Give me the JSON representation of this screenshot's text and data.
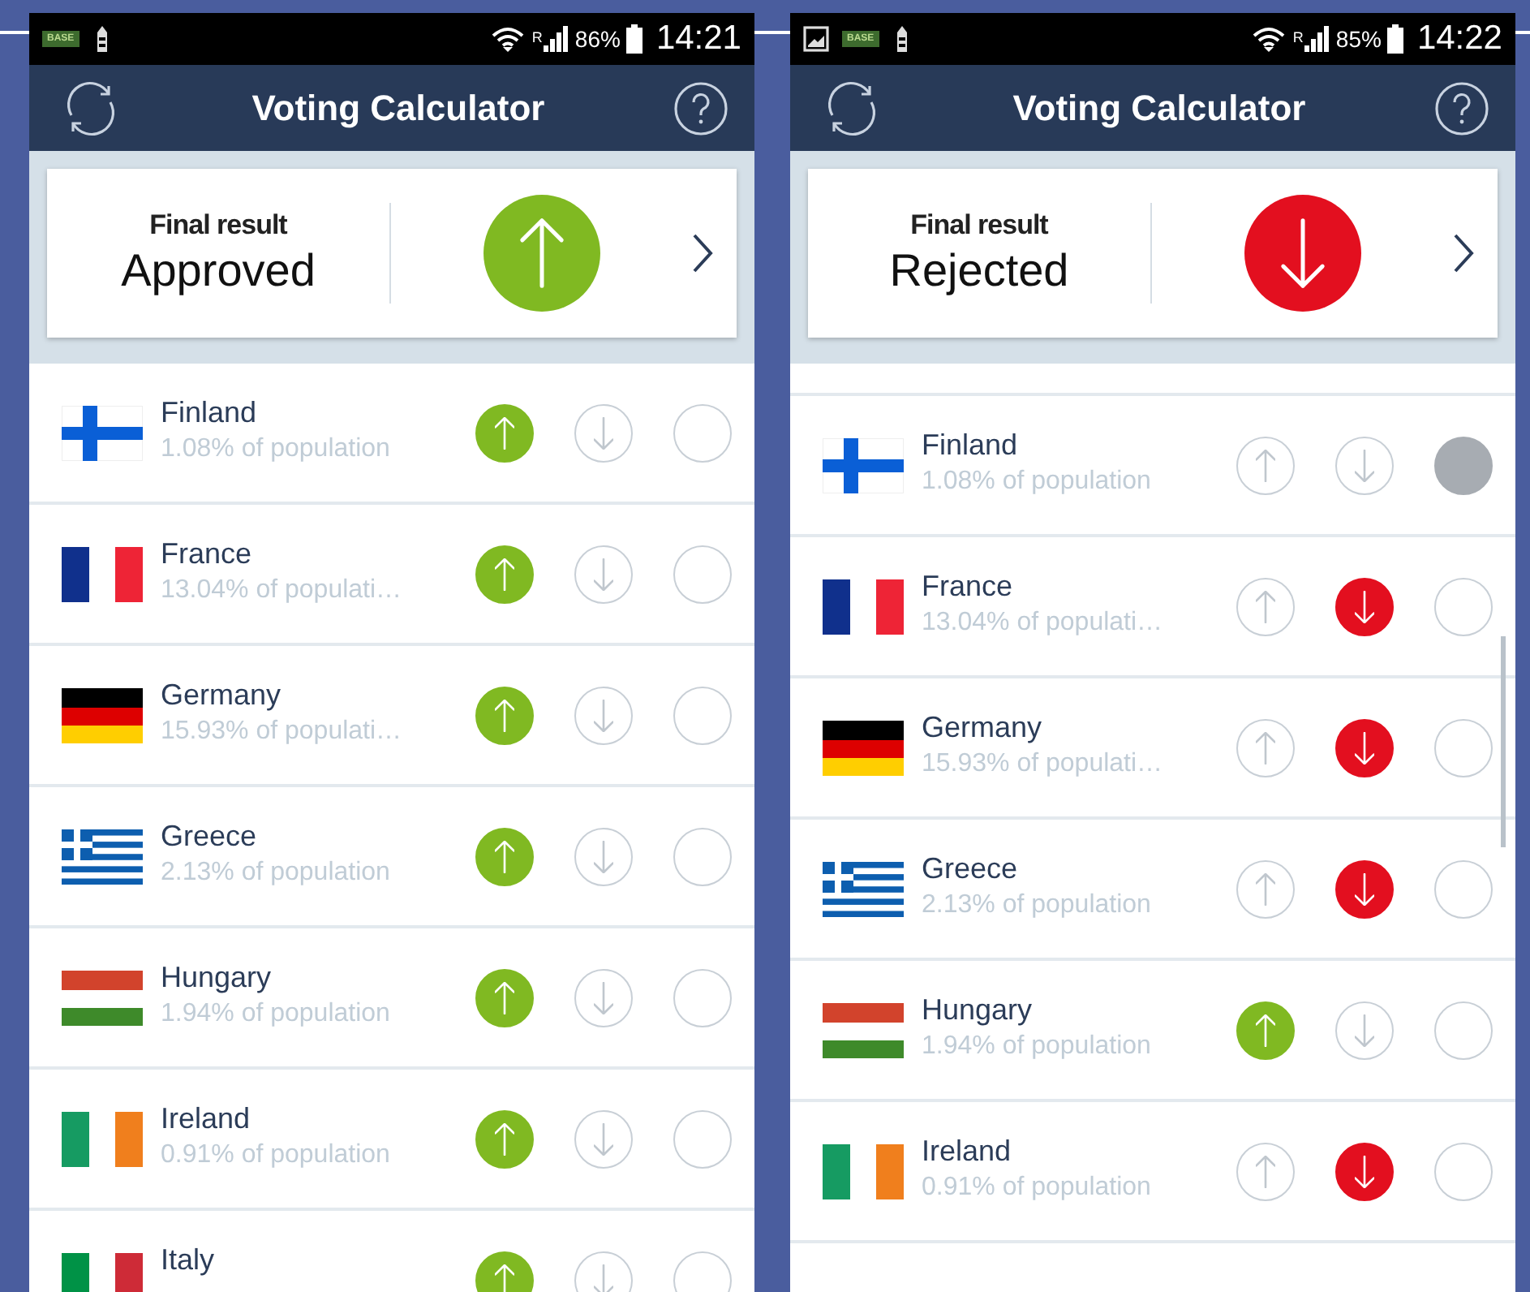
{
  "screens": [
    {
      "status": {
        "notifications": [
          {
            "kind": "badge",
            "text": "BASE"
          },
          {
            "kind": "tower"
          }
        ],
        "roaming": "R",
        "battery": "86%",
        "time": "14:21"
      },
      "title": "Voting Calculator",
      "result": {
        "label": "Final result",
        "value": "Approved",
        "kind": "approved"
      },
      "scrolled": false,
      "scrollbar": false,
      "countries": [
        {
          "kind": "fi",
          "name": "Finland",
          "population": "1.08% of population",
          "options": [
            {
              "kind": "yes",
              "selected": true
            },
            {
              "kind": "no",
              "selected": false
            },
            {
              "kind": "abstain",
              "selected": false
            }
          ]
        },
        {
          "kind": "fr",
          "name": "France",
          "population": "13.04% of populati…",
          "options": [
            {
              "kind": "yes",
              "selected": true
            },
            {
              "kind": "no",
              "selected": false
            },
            {
              "kind": "abstain",
              "selected": false
            }
          ]
        },
        {
          "kind": "de",
          "name": "Germany",
          "population": "15.93% of populati…",
          "options": [
            {
              "kind": "yes",
              "selected": true
            },
            {
              "kind": "no",
              "selected": false
            },
            {
              "kind": "abstain",
              "selected": false
            }
          ]
        },
        {
          "kind": "gr",
          "name": "Greece",
          "population": "2.13% of population",
          "options": [
            {
              "kind": "yes",
              "selected": true
            },
            {
              "kind": "no",
              "selected": false
            },
            {
              "kind": "abstain",
              "selected": false
            }
          ]
        },
        {
          "kind": "hu",
          "name": "Hungary",
          "population": "1.94% of population",
          "options": [
            {
              "kind": "yes",
              "selected": true
            },
            {
              "kind": "no",
              "selected": false
            },
            {
              "kind": "abstain",
              "selected": false
            }
          ]
        },
        {
          "kind": "ie",
          "name": "Ireland",
          "population": "0.91% of population",
          "options": [
            {
              "kind": "yes",
              "selected": true
            },
            {
              "kind": "no",
              "selected": false
            },
            {
              "kind": "abstain",
              "selected": false
            }
          ]
        },
        {
          "kind": "it",
          "name": "Italy",
          "options": [
            {
              "kind": "yes",
              "selected": true
            },
            {
              "kind": "no",
              "selected": false
            },
            {
              "kind": "abstain",
              "selected": false
            }
          ]
        }
      ]
    },
    {
      "status": {
        "notifications": [
          {
            "kind": "image"
          },
          {
            "kind": "badge",
            "text": "BASE"
          },
          {
            "kind": "tower"
          }
        ],
        "roaming": "R",
        "battery": "85%",
        "time": "14:22"
      },
      "title": "Voting Calculator",
      "result": {
        "label": "Final result",
        "value": "Rejected",
        "kind": "rejected"
      },
      "scrolled": true,
      "scrollbar": true,
      "countries": [
        {
          "kind": "fi",
          "name": "Finland",
          "population": "1.08% of population",
          "options": [
            {
              "kind": "yes",
              "selected": false
            },
            {
              "kind": "no",
              "selected": false
            },
            {
              "kind": "abstain",
              "selected": true
            }
          ]
        },
        {
          "kind": "fr",
          "name": "France",
          "population": "13.04% of populati…",
          "options": [
            {
              "kind": "yes",
              "selected": false
            },
            {
              "kind": "no",
              "selected": true
            },
            {
              "kind": "abstain",
              "selected": false
            }
          ]
        },
        {
          "kind": "de",
          "name": "Germany",
          "population": "15.93% of populati…",
          "options": [
            {
              "kind": "yes",
              "selected": false
            },
            {
              "kind": "no",
              "selected": true
            },
            {
              "kind": "abstain",
              "selected": false
            }
          ]
        },
        {
          "kind": "gr",
          "name": "Greece",
          "population": "2.13% of population",
          "options": [
            {
              "kind": "yes",
              "selected": false
            },
            {
              "kind": "no",
              "selected": true
            },
            {
              "kind": "abstain",
              "selected": false
            }
          ]
        },
        {
          "kind": "hu",
          "name": "Hungary",
          "population": "1.94% of population",
          "options": [
            {
              "kind": "yes",
              "selected": true
            },
            {
              "kind": "no",
              "selected": false
            },
            {
              "kind": "abstain",
              "selected": false
            }
          ]
        },
        {
          "kind": "ie",
          "name": "Ireland",
          "population": "0.91% of population",
          "options": [
            {
              "kind": "yes",
              "selected": false
            },
            {
              "kind": "no",
              "selected": true
            },
            {
              "kind": "abstain",
              "selected": false
            }
          ]
        }
      ]
    }
  ]
}
